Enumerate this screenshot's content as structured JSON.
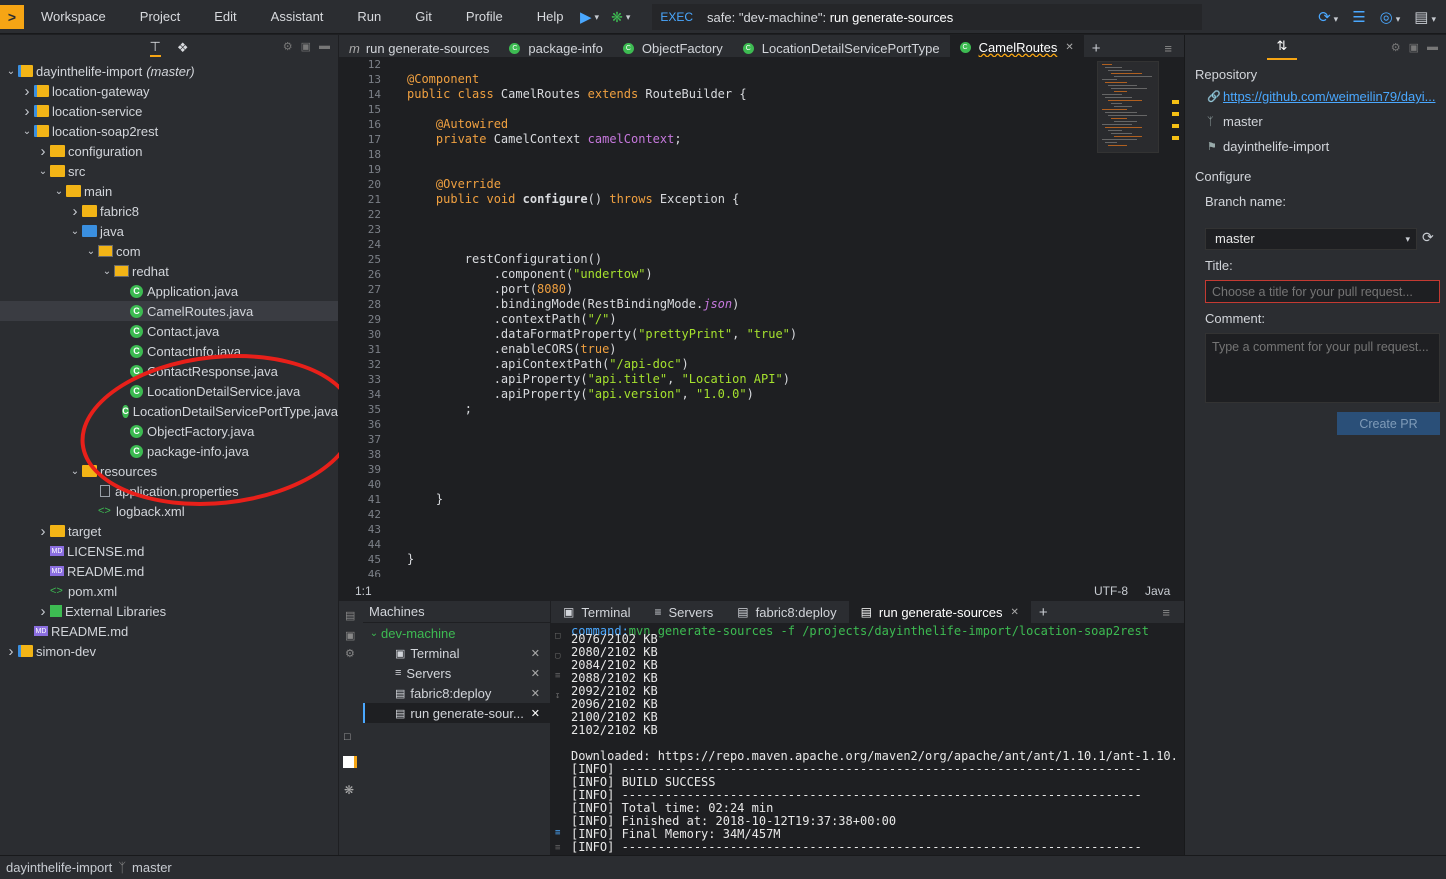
{
  "menu": {
    "logo": ">",
    "items": [
      "Workspace",
      "Project",
      "Edit",
      "Assistant",
      "Run",
      "Git",
      "Profile",
      "Help"
    ]
  },
  "toolbar": {
    "exec_tag": "EXEC",
    "exec_prefix": "safe: \"dev-machine\": ",
    "exec_command": "run generate-sources"
  },
  "project_tree": [
    {
      "depth": 0,
      "arrow": "open",
      "icon": "folder-project",
      "label": "dayinthelife-import",
      "suffix": "(master)"
    },
    {
      "depth": 1,
      "arrow": "closed",
      "icon": "folder-project",
      "label": "location-gateway"
    },
    {
      "depth": 1,
      "arrow": "closed",
      "icon": "folder-project",
      "label": "location-service"
    },
    {
      "depth": 1,
      "arrow": "open",
      "icon": "folder-project",
      "label": "location-soap2rest"
    },
    {
      "depth": 2,
      "arrow": "closed",
      "icon": "folder",
      "label": "configuration"
    },
    {
      "depth": 2,
      "arrow": "open",
      "icon": "folder",
      "label": "src"
    },
    {
      "depth": 3,
      "arrow": "open",
      "icon": "folder",
      "label": "main"
    },
    {
      "depth": 4,
      "arrow": "closed",
      "icon": "folder",
      "label": "fabric8"
    },
    {
      "depth": 4,
      "arrow": "open",
      "icon": "folder-blue",
      "label": "java"
    },
    {
      "depth": 5,
      "arrow": "open",
      "icon": "package",
      "label": "com"
    },
    {
      "depth": 6,
      "arrow": "open",
      "icon": "package",
      "label": "redhat"
    },
    {
      "depth": 7,
      "arrow": "none",
      "icon": "java",
      "label": "Application.java"
    },
    {
      "depth": 7,
      "arrow": "none",
      "icon": "java",
      "label": "CamelRoutes.java",
      "selected": true
    },
    {
      "depth": 7,
      "arrow": "none",
      "icon": "java",
      "label": "Contact.java"
    },
    {
      "depth": 7,
      "arrow": "none",
      "icon": "java",
      "label": "ContactInfo.java"
    },
    {
      "depth": 7,
      "arrow": "none",
      "icon": "java",
      "label": "ContactResponse.java"
    },
    {
      "depth": 7,
      "arrow": "none",
      "icon": "java",
      "label": "LocationDetailService.java"
    },
    {
      "depth": 7,
      "arrow": "none",
      "icon": "java",
      "label": "LocationDetailServicePortType.java"
    },
    {
      "depth": 7,
      "arrow": "none",
      "icon": "java",
      "label": "ObjectFactory.java"
    },
    {
      "depth": 7,
      "arrow": "none",
      "icon": "java",
      "label": "package-info.java"
    },
    {
      "depth": 4,
      "arrow": "open",
      "icon": "folder",
      "label": "resources"
    },
    {
      "depth": 5,
      "arrow": "none",
      "icon": "file",
      "label": "application.properties"
    },
    {
      "depth": 5,
      "arrow": "none",
      "icon": "xml",
      "label": "logback.xml"
    },
    {
      "depth": 2,
      "arrow": "closed",
      "icon": "folder",
      "label": "target"
    },
    {
      "depth": 2,
      "arrow": "none",
      "icon": "md",
      "label": "LICENSE.md"
    },
    {
      "depth": 2,
      "arrow": "none",
      "icon": "md",
      "label": "README.md"
    },
    {
      "depth": 2,
      "arrow": "none",
      "icon": "xml",
      "label": "pom.xml"
    },
    {
      "depth": 2,
      "arrow": "closed",
      "icon": "library",
      "label": "External Libraries"
    },
    {
      "depth": 1,
      "arrow": "none",
      "icon": "md",
      "label": "README.md"
    },
    {
      "depth": 0,
      "arrow": "closed",
      "icon": "folder-project",
      "label": "simon-dev"
    }
  ],
  "editor_tabs": [
    {
      "icon": "m",
      "label": "run generate-sources"
    },
    {
      "icon": "c",
      "label": "package-info"
    },
    {
      "icon": "c",
      "label": "ObjectFactory"
    },
    {
      "icon": "c",
      "label": "LocationDetailServicePortType"
    },
    {
      "icon": "c",
      "label": "CamelRoutes",
      "active": true
    }
  ],
  "code_lines": [
    {
      "n": "12",
      "html": ""
    },
    {
      "n": "13",
      "html": "<span class='an'>@Component</span>"
    },
    {
      "n": "14",
      "html": "<span class='kw'>public class</span> CamelRoutes <span class='kw'>extends</span> RouteBuilder {"
    },
    {
      "n": "15",
      "html": ""
    },
    {
      "n": "16",
      "html": "    <span class='an'>@Autowired</span>"
    },
    {
      "n": "17",
      "html": "    <span class='kw'>private</span> CamelContext <span class='fld'>camelContext</span>;"
    },
    {
      "n": "18",
      "html": ""
    },
    {
      "n": "19",
      "html": ""
    },
    {
      "n": "20",
      "html": "    <span class='an'>@Override</span>"
    },
    {
      "n": "21",
      "html": "    <span class='kw'>public void</span> <b>configure</b>() <span class='kw'>throws</span> Exception {"
    },
    {
      "n": "22",
      "html": ""
    },
    {
      "n": "23",
      "html": ""
    },
    {
      "n": "24",
      "html": ""
    },
    {
      "n": "25",
      "html": "        restConfiguration()"
    },
    {
      "n": "26",
      "html": "            .component(<span class='str'>\"undertow\"</span>)"
    },
    {
      "n": "27",
      "html": "            .port(<span class='num'>8080</span>)"
    },
    {
      "n": "28",
      "html": "            .bindingMode(RestBindingMode.<span class='it'>json</span>)"
    },
    {
      "n": "29",
      "html": "            .contextPath(<span class='str'>\"/\"</span>)"
    },
    {
      "n": "30",
      "html": "            .dataFormatProperty(<span class='str'>\"prettyPrint\"</span>, <span class='str'>\"true\"</span>)"
    },
    {
      "n": "31",
      "html": "            .enableCORS(<span class='kw'>true</span>)"
    },
    {
      "n": "32",
      "html": "            .apiContextPath(<span class='str'>\"/api-doc\"</span>)"
    },
    {
      "n": "33",
      "html": "            .apiProperty(<span class='str'>\"api.title\"</span>, <span class='str'>\"Location API\"</span>)"
    },
    {
      "n": "34",
      "html": "            .apiProperty(<span class='str'>\"api.version\"</span>, <span class='str'>\"1.0.0\"</span>)"
    },
    {
      "n": "35",
      "html": "        ;"
    },
    {
      "n": "36",
      "html": ""
    },
    {
      "n": "37",
      "html": ""
    },
    {
      "n": "38",
      "html": ""
    },
    {
      "n": "39",
      "html": ""
    },
    {
      "n": "40",
      "html": ""
    },
    {
      "n": "41",
      "html": "    }"
    },
    {
      "n": "42",
      "html": ""
    },
    {
      "n": "43",
      "html": ""
    },
    {
      "n": "44",
      "html": ""
    },
    {
      "n": "45",
      "html": "}"
    },
    {
      "n": "46",
      "html": ""
    }
  ],
  "editor_status": {
    "position": "1:1",
    "encoding": "UTF-8",
    "language": "Java"
  },
  "machines": {
    "header": "Machines",
    "machine": "dev-machine",
    "items": [
      {
        "icon": "terminal",
        "label": "Terminal"
      },
      {
        "icon": "servers",
        "label": "Servers"
      },
      {
        "icon": "cmd",
        "label": "fabric8:deploy"
      },
      {
        "icon": "cmd",
        "label": "run generate-sour...",
        "selected": true
      }
    ]
  },
  "terminal_tabs": [
    {
      "label": "Terminal"
    },
    {
      "label": "Servers"
    },
    {
      "label": "fabric8:deploy"
    },
    {
      "label": "run generate-sources",
      "active": true
    }
  ],
  "terminal": {
    "command_label": "command:",
    "command": "mvn generate-sources -f /projects/dayinthelife-import/location-soap2rest",
    "lines": [
      "2076/2102 KB",
      "2080/2102 KB",
      "2084/2102 KB",
      "2088/2102 KB",
      "2092/2102 KB",
      "2096/2102 KB",
      "2100/2102 KB",
      "2102/2102 KB",
      "",
      "Downloaded: https://repo.maven.apache.org/maven2/org/apache/ant/ant/1.10.1/ant-1.10.",
      "[INFO] ------------------------------------------------------------------------",
      "[INFO] BUILD SUCCESS",
      "[INFO] ------------------------------------------------------------------------",
      "[INFO] Total time: 02:24 min",
      "[INFO] Finished at: 2018-10-12T19:37:38+00:00",
      "[INFO] Final Memory: 34M/457M",
      "[INFO] ------------------------------------------------------------------------"
    ]
  },
  "pull_request": {
    "repository_label": "Repository",
    "repo_url": "https://github.com/weimeilin79/dayi...",
    "branch": "master",
    "project": "dayinthelife-import",
    "configure_label": "Configure",
    "branch_name_label": "Branch name:",
    "branch_selected": "master",
    "title_label": "Title:",
    "title_placeholder": "Choose a title for your pull request...",
    "comment_label": "Comment:",
    "comment_placeholder": "Type a comment for your pull request...",
    "create_button": "Create PR"
  },
  "statusbar": {
    "project": "dayinthelife-import",
    "branch": "master"
  },
  "colors": {
    "accent": "#4aa8ff",
    "brand": "#f6a514",
    "annotation": "#e8201a"
  }
}
